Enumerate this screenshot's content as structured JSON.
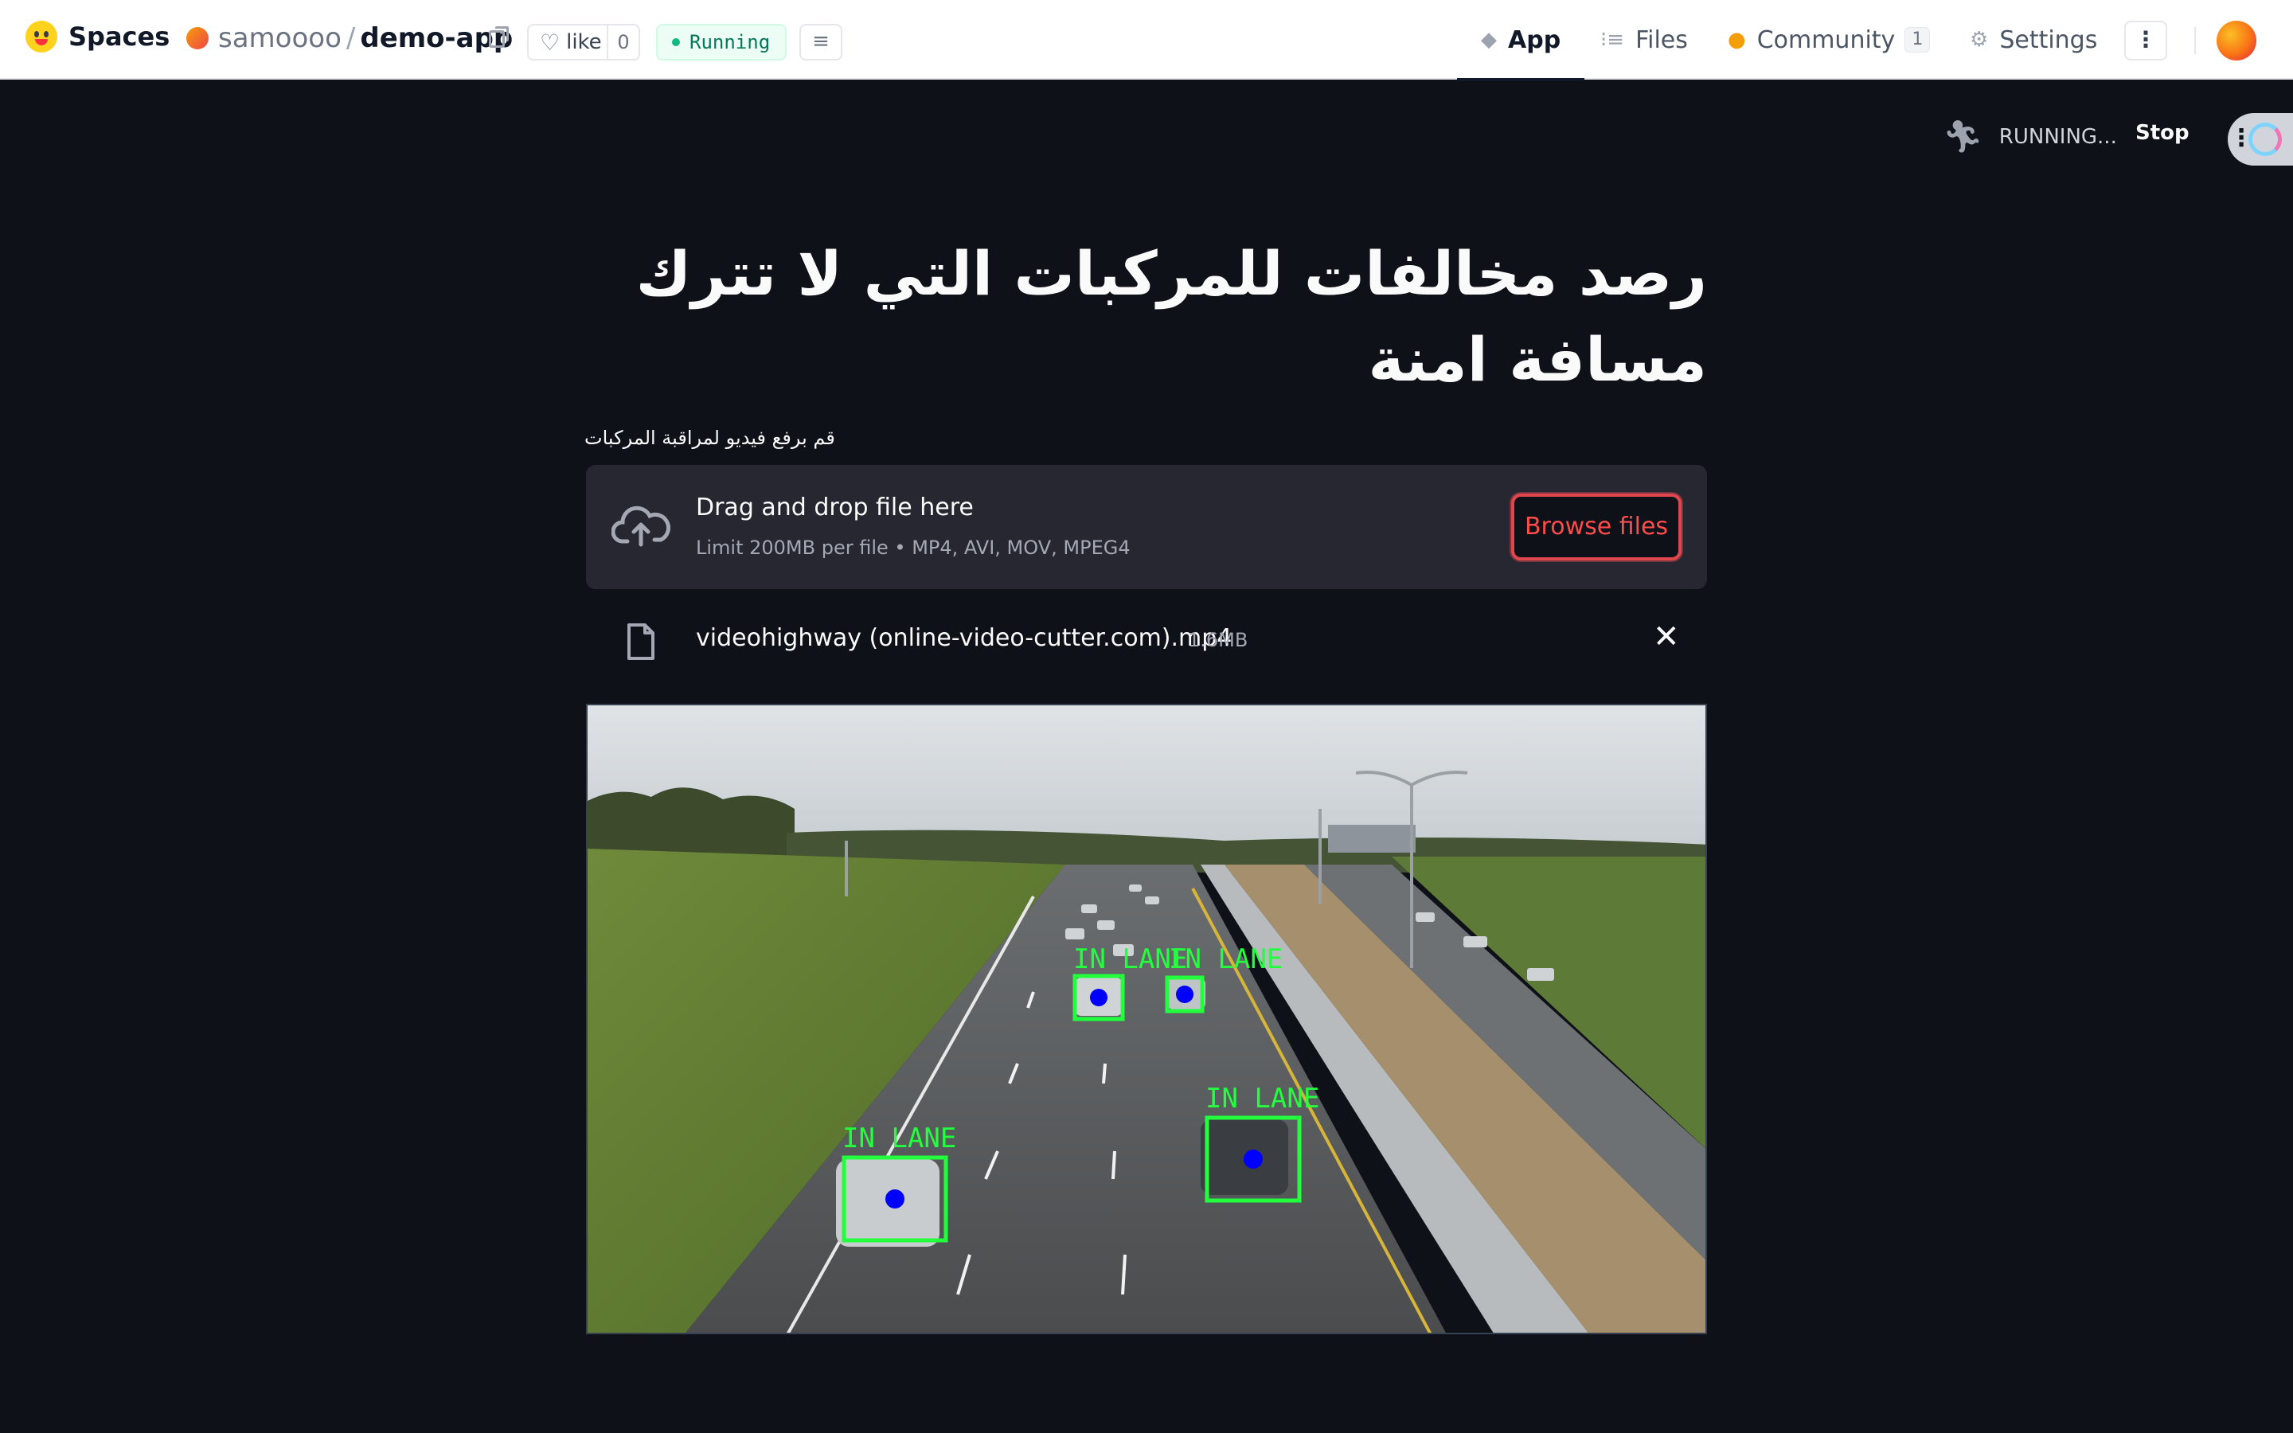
{
  "topbar": {
    "brand": "Spaces",
    "repo_owner": "samoooo",
    "repo_separator": "/",
    "repo_name": "demo-app",
    "like_label": "like",
    "like_count": "0",
    "status": "Running",
    "tabs": [
      {
        "label": "App",
        "icon": "cube-icon",
        "active": true
      },
      {
        "label": "Files",
        "icon": "files-icon",
        "active": false
      },
      {
        "label": "Community",
        "icon": "community-icon",
        "badge": "1",
        "active": false
      },
      {
        "label": "Settings",
        "icon": "gear-icon",
        "active": false
      }
    ],
    "more_label": "⋮"
  },
  "header": {
    "running_text": "RUNNING...",
    "stop_label": "Stop"
  },
  "main": {
    "title_line1": "رصد مخالفات للمركبات التي لا تترك",
    "title_line2": "مسافة امنة",
    "uploader_label": "قم برفع فيديو لمراقبة المركبات",
    "dropzone_title": "Drag and drop file here",
    "dropzone_limit": "Limit 200MB per file • MP4, AVI, MOV, MPEG4",
    "browse_label": "Browse files",
    "file_name": "videohighway (online-video-cutter.com).mp4",
    "file_size": "1.6MB"
  },
  "video": {
    "detections": [
      {
        "label": "IN LANE"
      },
      {
        "label": "IN LANE"
      },
      {
        "label": "IN LANE"
      },
      {
        "label": "IN LANE"
      }
    ]
  },
  "colors": {
    "accent": "#ff4b4b",
    "background": "#0e1117",
    "surface": "#262730",
    "detection_box": "#22ff3c",
    "detection_dot": "#0000ff",
    "status_green": "#10b981"
  }
}
